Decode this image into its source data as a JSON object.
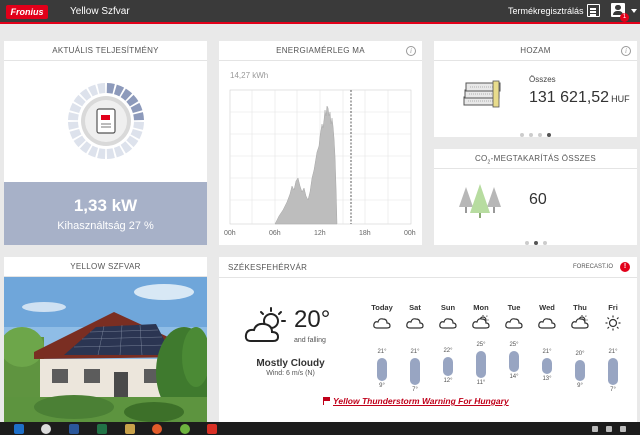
{
  "header": {
    "logo_text": "Fronius",
    "site_name": "Yellow Szfvar",
    "registration_link": "Termékregisztrálás",
    "notification_count": "1",
    "icons": [
      "register-icon",
      "user-icon",
      "caret-down-icon"
    ]
  },
  "power_card": {
    "title": "AKTUÁLIS TELJESÍTMÉNY",
    "value": "1,33 kW",
    "utilization": "Kihasználtság 27 %",
    "utilization_percent": 27,
    "colors": {
      "band": "#a7b1c8",
      "gauge_active": "#8d9abb",
      "gauge_inactive": "#dde2ec"
    }
  },
  "energy_card": {
    "title": "ENERGIAMÉRLEG MA",
    "max_label": "14,27 kWh",
    "x_ticks": [
      "00h",
      "06h",
      "12h",
      "18h",
      "00h"
    ]
  },
  "yield_card": {
    "title": "HOZAM",
    "label": "Összes",
    "value": "131 621,52",
    "unit": "HUF",
    "dots_total": 4,
    "dots_active": 4
  },
  "co2_card": {
    "title_prefix": "CO",
    "title_sub": "2",
    "title_suffix": "-MEGTAKARÍTÁS ÖSSZES",
    "value": "60",
    "dots_total": 3,
    "dots_active": 2
  },
  "system_card": {
    "title": "YELLOW SZFVAR"
  },
  "weather": {
    "city": "SZÉKESFEHÉRVÁR",
    "provider": "FORECAST.IO",
    "alert_icon": "!",
    "current": {
      "temp": "20°",
      "trend": "and falling",
      "condition": "Mostly Cloudy",
      "wind": "Wind: 6 m/s (N)",
      "icon": "partly-cloudy-icon"
    },
    "forecast": [
      {
        "day": "Today",
        "icon": "cloud-icon",
        "high": "21°",
        "low": "9°",
        "high_val": 21,
        "low_val": 9
      },
      {
        "day": "Sat",
        "icon": "cloud-icon",
        "high": "21°",
        "low": "7°",
        "high_val": 21,
        "low_val": 7
      },
      {
        "day": "Sun",
        "icon": "cloud-icon",
        "high": "22°",
        "low": "12°",
        "high_val": 22,
        "low_val": 12
      },
      {
        "day": "Mon",
        "icon": "partly-cloudy-icon",
        "high": "25°",
        "low": "11°",
        "high_val": 25,
        "low_val": 11
      },
      {
        "day": "Tue",
        "icon": "cloud-icon",
        "high": "25°",
        "low": "14°",
        "high_val": 25,
        "low_val": 14
      },
      {
        "day": "Wed",
        "icon": "cloud-icon",
        "high": "21°",
        "low": "13°",
        "high_val": 21,
        "low_val": 13
      },
      {
        "day": "Thu",
        "icon": "partly-cloudy-icon",
        "high": "20°",
        "low": "9°",
        "high_val": 20,
        "low_val": 9
      },
      {
        "day": "Fri",
        "icon": "sun-icon",
        "high": "21°",
        "low": "7°",
        "high_val": 21,
        "low_val": 7
      }
    ],
    "warning": "Yellow Thunderstorm Warning For Hungary"
  }
}
